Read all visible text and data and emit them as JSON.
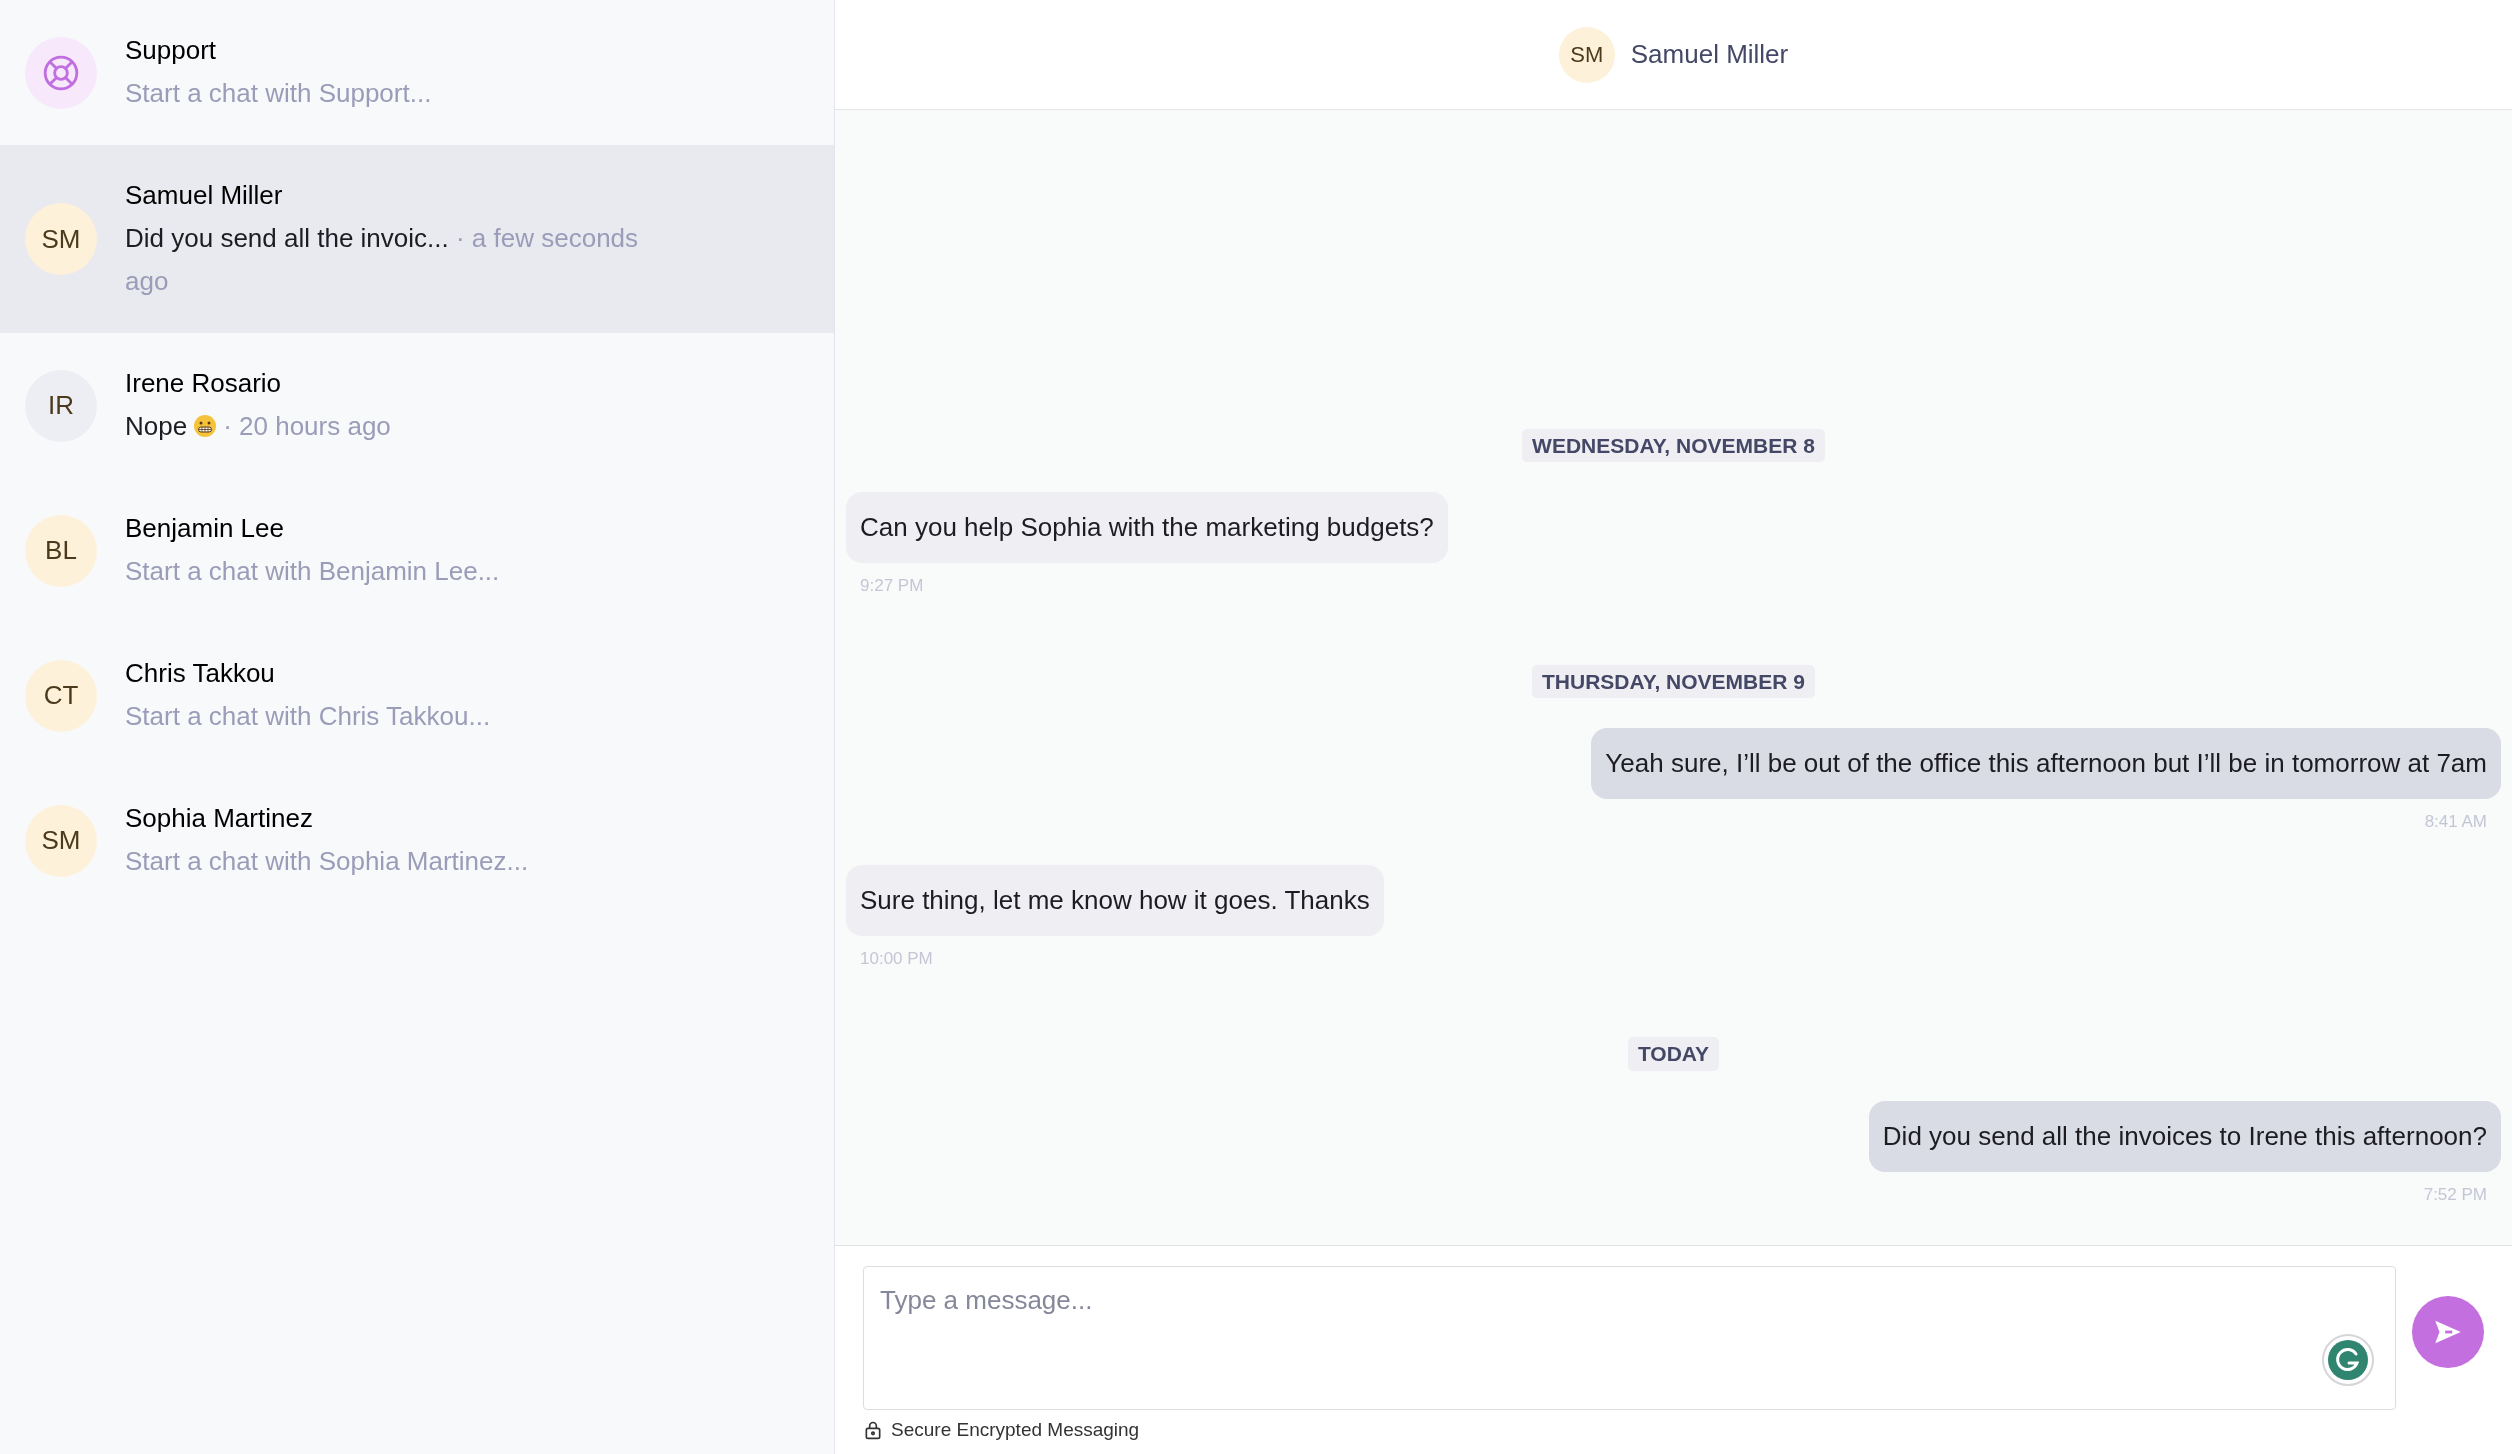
{
  "sidebar": {
    "conversations": [
      {
        "kind": "support",
        "name": "Support",
        "preview": "Start a chat with Support...",
        "selected": false
      },
      {
        "kind": "person",
        "initials": "SM",
        "color": "#fdf1d9",
        "name": "Samuel Miller",
        "preview": "Did you send all the invoic...",
        "time": "· a few seconds ago",
        "unread": true,
        "selected": true
      },
      {
        "kind": "person",
        "initials": "IR",
        "color": "#eceef4",
        "name": "Irene Rosario",
        "preview": "Nope",
        "emoji": true,
        "time": "· 20 hours ago",
        "unread": true,
        "selected": false
      },
      {
        "kind": "person",
        "initials": "BL",
        "color": "#fdf1d9",
        "name": "Benjamin Lee",
        "preview": "Start a chat with Benjamin Lee...",
        "selected": false
      },
      {
        "kind": "person",
        "initials": "CT",
        "color": "#fdf1d9",
        "name": "Chris Takkou",
        "preview": "Start a chat with Chris Takkou...",
        "selected": false
      },
      {
        "kind": "person",
        "initials": "SM",
        "color": "#fdf1d9",
        "name": "Sophia Martinez",
        "preview": "Start a chat with Sophia Martinez...",
        "selected": false
      }
    ]
  },
  "chat": {
    "header": {
      "initials": "SM",
      "name": "Samuel Miller"
    },
    "items": [
      {
        "kind": "date",
        "label": "WEDNESDAY, NOVEMBER 8"
      },
      {
        "kind": "incoming",
        "text": "Can you help Sophia with the marketing budgets?",
        "time": "9:27 PM"
      },
      {
        "kind": "date",
        "label": "THURSDAY, NOVEMBER 9"
      },
      {
        "kind": "outgoing",
        "text": "Yeah sure, I’ll be out of the office this afternoon but I’ll be in tomorrow at 7am",
        "time": "8:41 AM"
      },
      {
        "kind": "incoming",
        "text": "Sure thing, let me know how it goes. Thanks",
        "time": "10:00 PM"
      },
      {
        "kind": "date",
        "label": "TODAY"
      },
      {
        "kind": "outgoing",
        "text": "Did you send all the invoices to Irene this afternoon?",
        "time": "7:52 PM"
      }
    ],
    "composer": {
      "placeholder": "Type a message...",
      "note": "Secure Encrypted Messaging"
    }
  }
}
